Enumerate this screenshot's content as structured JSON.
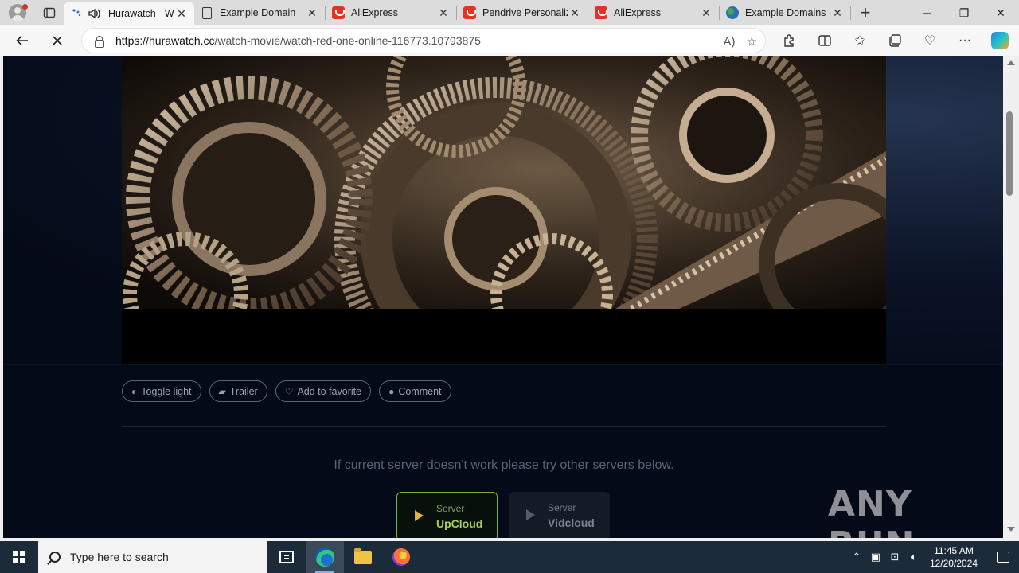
{
  "browser": {
    "tabs": [
      {
        "title": "Hurawatch - W",
        "favicon": "loading-spinner",
        "active": true
      },
      {
        "title": "Example Domain",
        "favicon": "document-icon"
      },
      {
        "title": "AliExpress",
        "favicon": "aliexpress-icon"
      },
      {
        "title": "Pendrive Personaliz",
        "favicon": "aliexpress-icon"
      },
      {
        "title": "AliExpress",
        "favicon": "aliexpress-icon"
      },
      {
        "title": "Example Domains",
        "favicon": "globe-icon"
      }
    ],
    "url_host": "https://hurawatch.cc",
    "url_path": "/watch-movie/watch-red-one-online-116773.10793875"
  },
  "page": {
    "actions": [
      {
        "icon": "◐",
        "label": "Toggle light"
      },
      {
        "icon": "▰",
        "label": "Trailer"
      },
      {
        "icon": "♡",
        "label": "Add to favorite"
      },
      {
        "icon": "●",
        "label": "Comment"
      }
    ],
    "notice": "If current server doesn't work please try other servers below.",
    "servers": [
      {
        "label": "Server",
        "name": "UpCloud",
        "active": true
      },
      {
        "label": "Server",
        "name": "Vidcloud",
        "active": false
      }
    ],
    "watermark": "ANY RUN"
  },
  "taskbar": {
    "search_placeholder": "Type here to search",
    "time": "11:45 AM",
    "date": "12/20/2024"
  },
  "colors": {
    "page_bg": "#050a18",
    "server_active_border": "#7fae2f",
    "server_active_text": "#a6cf52",
    "play_icon": "#e2b33a"
  }
}
